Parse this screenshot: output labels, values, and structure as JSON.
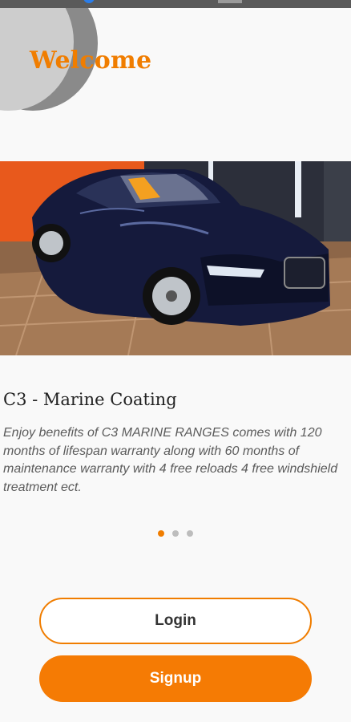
{
  "header": {
    "welcome": "Welcome"
  },
  "carousel": {
    "current_index": 1,
    "total_slides": 3,
    "slide": {
      "title": "C3 - Marine Coating",
      "description": "Enjoy benefits of C3 MARINE RANGES comes with 120 months of lifespan warranty along with 60 months of maintenance warranty with 4 free reloads 4 free windshield treatment ect."
    }
  },
  "actions": {
    "login_label": "Login",
    "signup_label": "Signup"
  },
  "colors": {
    "accent": "#f07d00",
    "background": "#f9f9f9"
  }
}
